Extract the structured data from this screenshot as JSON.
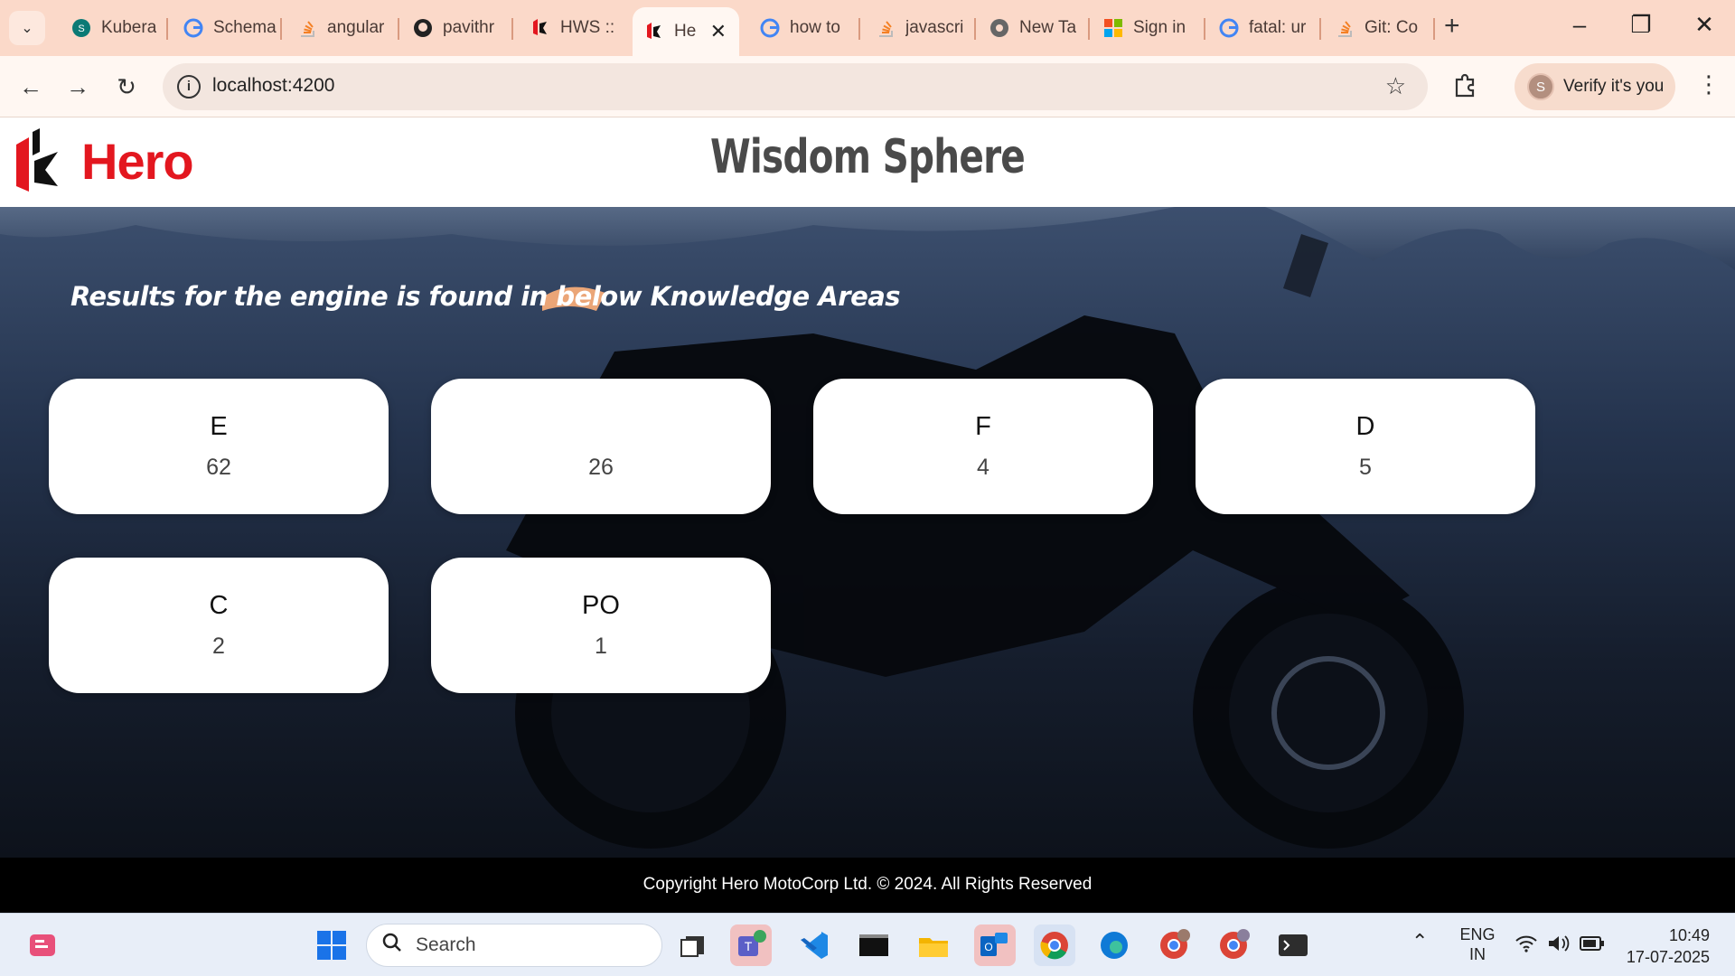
{
  "browser": {
    "tabs": [
      {
        "label": "Kubera",
        "icon": "sharepoint-icon"
      },
      {
        "label": "Schema",
        "icon": "google-icon"
      },
      {
        "label": "angular",
        "icon": "stackoverflow-icon"
      },
      {
        "label": "pavithr",
        "icon": "github-icon"
      },
      {
        "label": "HWS ::",
        "icon": "hero-icon"
      },
      {
        "label": "He",
        "icon": "hero-icon",
        "active": true
      },
      {
        "label": "how to",
        "icon": "google-icon"
      },
      {
        "label": "javascri",
        "icon": "stackoverflow-icon"
      },
      {
        "label": "New Ta",
        "icon": "chrome-icon"
      },
      {
        "label": "Sign in",
        "icon": "microsoft-icon"
      },
      {
        "label": "fatal: ur",
        "icon": "google-icon"
      },
      {
        "label": "Git: Co",
        "icon": "stackoverflow-icon"
      }
    ],
    "url": "localhost:4200",
    "profile": {
      "initial": "S",
      "label": "Verify it's you"
    }
  },
  "page": {
    "brand": "Hero",
    "title": "Wisdom Sphere",
    "results_heading": "Results for the engine is found in below Knowledge Areas",
    "knowledge_areas": [
      {
        "name": "E",
        "count": "62"
      },
      {
        "name": "",
        "count": "26"
      },
      {
        "name": "F",
        "count": "4"
      },
      {
        "name": "D",
        "count": "5"
      },
      {
        "name": "C",
        "count": "2"
      },
      {
        "name": "PO",
        "count": "1"
      }
    ],
    "footer": "Copyright Hero MotoCorp Ltd. © 2024. All Rights Reserved"
  },
  "taskbar": {
    "search_placeholder": "Search",
    "language": "ENG",
    "region": "IN",
    "time": "10:49",
    "date": "17-07-2025",
    "apps": [
      "teams-icon",
      "vscode-icon",
      "terminal-icon",
      "file-explorer-icon",
      "outlook-icon",
      "chrome-icon",
      "edge-icon",
      "chrome-profile-s-icon",
      "chrome-profile-p-icon",
      "terminal-icon"
    ]
  },
  "colors": {
    "brand_red": "#e3171f",
    "tabstrip": "#fbd9c9",
    "card_bg": "#ffffff"
  }
}
